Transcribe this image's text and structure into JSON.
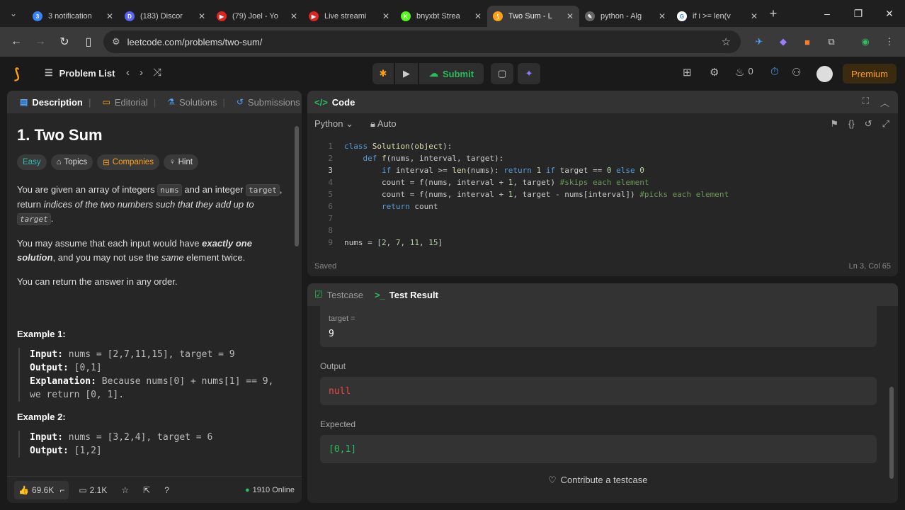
{
  "browser": {
    "tabs": [
      {
        "title": "3 notification",
        "fav": "3",
        "favcolor": "#3b82f6",
        "active": false
      },
      {
        "title": "(183) Discor",
        "fav": "D",
        "favcolor": "#5865f2",
        "active": false
      },
      {
        "title": "(79) Joel - Yo",
        "fav": "▶",
        "favcolor": "#e02424",
        "active": false
      },
      {
        "title": "Live streami",
        "fav": "▶",
        "favcolor": "#e02424",
        "active": false
      },
      {
        "title": "bnyxbt Strea",
        "fav": "K",
        "favcolor": "#53fc18",
        "active": false
      },
      {
        "title": "Two Sum - L",
        "fav": "⟆",
        "favcolor": "#ffa116",
        "active": true
      },
      {
        "title": "python - Alg",
        "fav": "✎",
        "favcolor": "#666666",
        "active": false
      },
      {
        "title": "if i >= len(v",
        "fav": "G",
        "favcolor": "#ffffff",
        "active": false
      }
    ],
    "url": "leetcode.com/problems/two-sum/"
  },
  "nav": {
    "problem_list": "Problem List",
    "submit": "Submit",
    "streak": "0",
    "premium": "Premium"
  },
  "left": {
    "tabs": [
      "Description",
      "Editorial",
      "Solutions",
      "Submissions"
    ],
    "title": "1. Two Sum",
    "chips": [
      "Easy",
      "Topics",
      "Companies",
      "Hint"
    ],
    "para1": {
      "a": "You are given an array of integers ",
      "c1": "nums",
      "b": " and an integer ",
      "c2": "target",
      "d": ", return ",
      "e": "indices of the two numbers such that they add up to",
      "c3": "target",
      "f": "."
    },
    "para2": {
      "a": "You may assume that each input would have ",
      "b": "exactly one solution",
      "c": ", and you may not use the ",
      "d": "same",
      "e": " element twice."
    },
    "para3": "You can return the answer in any order.",
    "example1": {
      "title": "Example 1:",
      "input_label": "Input:",
      "input": " nums = [2,7,11,15], target = 9",
      "output_label": "Output:",
      "output": " [0,1]",
      "expl_label": "Explanation:",
      "expl": " Because nums[0] + nums[1] == 9,",
      "expl2": "we return [0, 1]."
    },
    "example2": {
      "title": "Example 2:",
      "input_label": "Input:",
      "input": " nums = [3,2,4], target = 6",
      "output_label": "Output:",
      "output": " [1,2]"
    },
    "footer": {
      "likes": "69.6K",
      "comments": "2.1K",
      "online": "1910 Online"
    }
  },
  "code": {
    "header": "Code",
    "lang": "Python",
    "mode": "Auto",
    "status": "Saved",
    "position": "Ln 3, Col 65"
  },
  "result": {
    "tabs": [
      "Testcase",
      "Test Result"
    ],
    "target_label": "target =",
    "target_value": "9",
    "output_label": "Output",
    "output_value": "null",
    "expected_label": "Expected",
    "expected_value": "[0,1]",
    "contribute": "Contribute a testcase"
  }
}
